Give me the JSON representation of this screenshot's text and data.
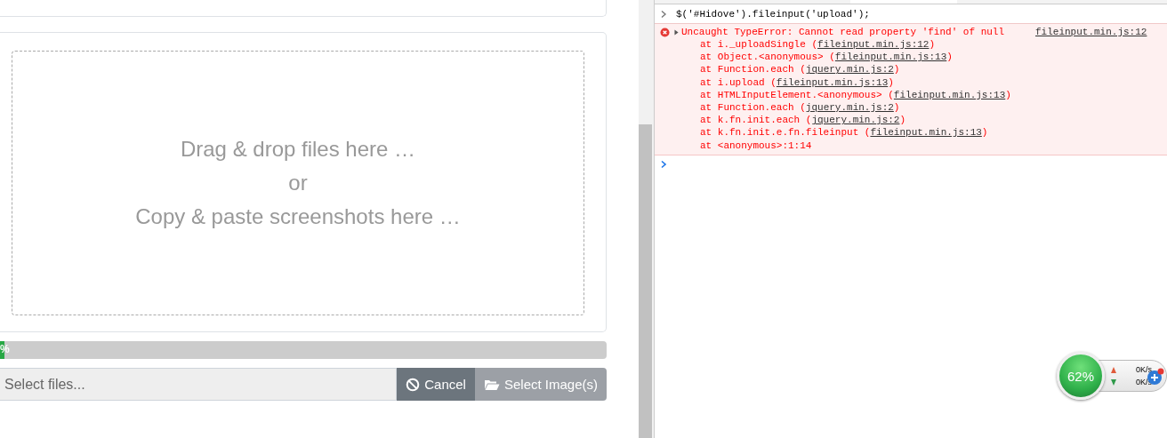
{
  "upload_panel": {
    "dropzone": {
      "lines": [
        "Drag & drop files here …",
        "or",
        "Copy & paste screenshots here …"
      ]
    },
    "progress": {
      "level": 0.008,
      "label": "%"
    },
    "caption": {
      "placeholder": "Select files..."
    },
    "buttons": [
      {
        "label": "Cancel",
        "kind": "cancel"
      },
      {
        "label": "Select Image(s)",
        "kind": "browse"
      }
    ]
  },
  "console": {
    "command": "$('#Hidove').fileinput('upload');",
    "error": {
      "message": "Uncaught TypeError: Cannot read property 'find' of null",
      "source": "fileinput.min.js:12",
      "frames": [
        {
          "text": "at i._uploadSingle (",
          "link": "fileinput.min.js:12",
          "end": ")"
        },
        {
          "text": "at Object.<anonymous> (",
          "link": "fileinput.min.js:13",
          "end": ")"
        },
        {
          "text": "at Function.each (",
          "link": "jquery.min.js:2",
          "end": ")"
        },
        {
          "text": "at i.upload (",
          "link": "fileinput.min.js:13",
          "end": ")"
        },
        {
          "text": "at HTMLInputElement.<anonymous> (",
          "link": "fileinput.min.js:13",
          "end": ")"
        },
        {
          "text": "at Function.each (",
          "link": "jquery.min.js:2",
          "end": ")"
        },
        {
          "text": "at k.fn.init.each (",
          "link": "jquery.min.js:2",
          "end": ")"
        },
        {
          "text": "at k.fn.init.e.fn.fileinput (",
          "link": "fileinput.min.js:13",
          "end": ")"
        },
        {
          "text": "at <anonymous>:1:14"
        }
      ]
    }
  },
  "speed_widget": {
    "percent": "62%",
    "upload": "0K/s",
    "download": "0K/s"
  }
}
